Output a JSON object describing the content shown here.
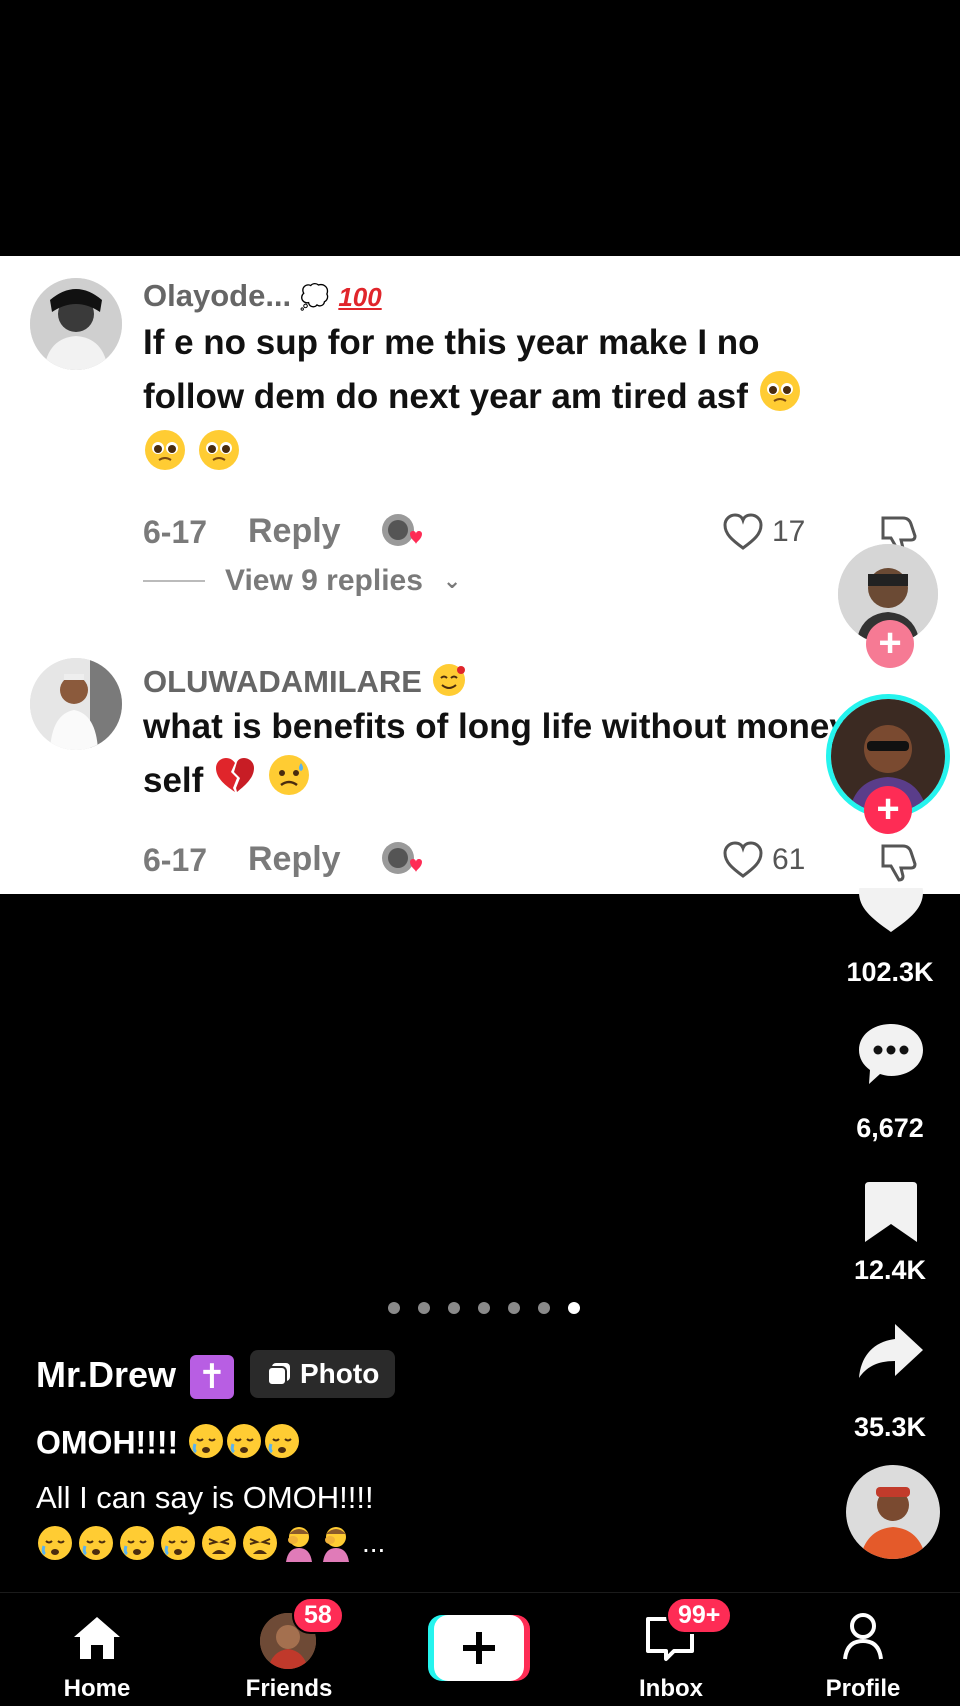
{
  "comments": [
    {
      "username": "Olayode...",
      "text": "If e no sup for me this year make I no follow dem do next year am tired asf",
      "date": "6-17",
      "reply_label": "Reply",
      "likes": "17"
    },
    {
      "username": "OLUWADAMILARE",
      "text": "what is benefits of long life without money self",
      "date": "6-17",
      "reply_label": "Reply",
      "likes": "61"
    }
  ],
  "view_replies": "View 9 replies",
  "rail": {
    "likes": "102.3K",
    "comments": "6,672",
    "saves": "12.4K",
    "shares": "35.3K"
  },
  "carousel": {
    "total": 7,
    "active_index": 6
  },
  "caption": {
    "author": "Mr.Drew",
    "photo_label": "Photo",
    "title": "OMOH!!!!",
    "text": "All I can say is OMOH!!!!",
    "more": "..."
  },
  "nav": {
    "home": "Home",
    "friends": "Friends",
    "friends_badge": "58",
    "inbox": "Inbox",
    "inbox_badge": "99+",
    "profile": "Profile"
  },
  "colors": {
    "accent": "#fe2c55",
    "cyan": "#25f4ee",
    "badge_purple": "#b85ee3"
  },
  "icons": [
    "heart-icon",
    "dislike-icon",
    "comment-icon",
    "bookmark-icon",
    "share-icon",
    "home-icon",
    "plus-icon",
    "inbox-icon",
    "profile-icon"
  ]
}
